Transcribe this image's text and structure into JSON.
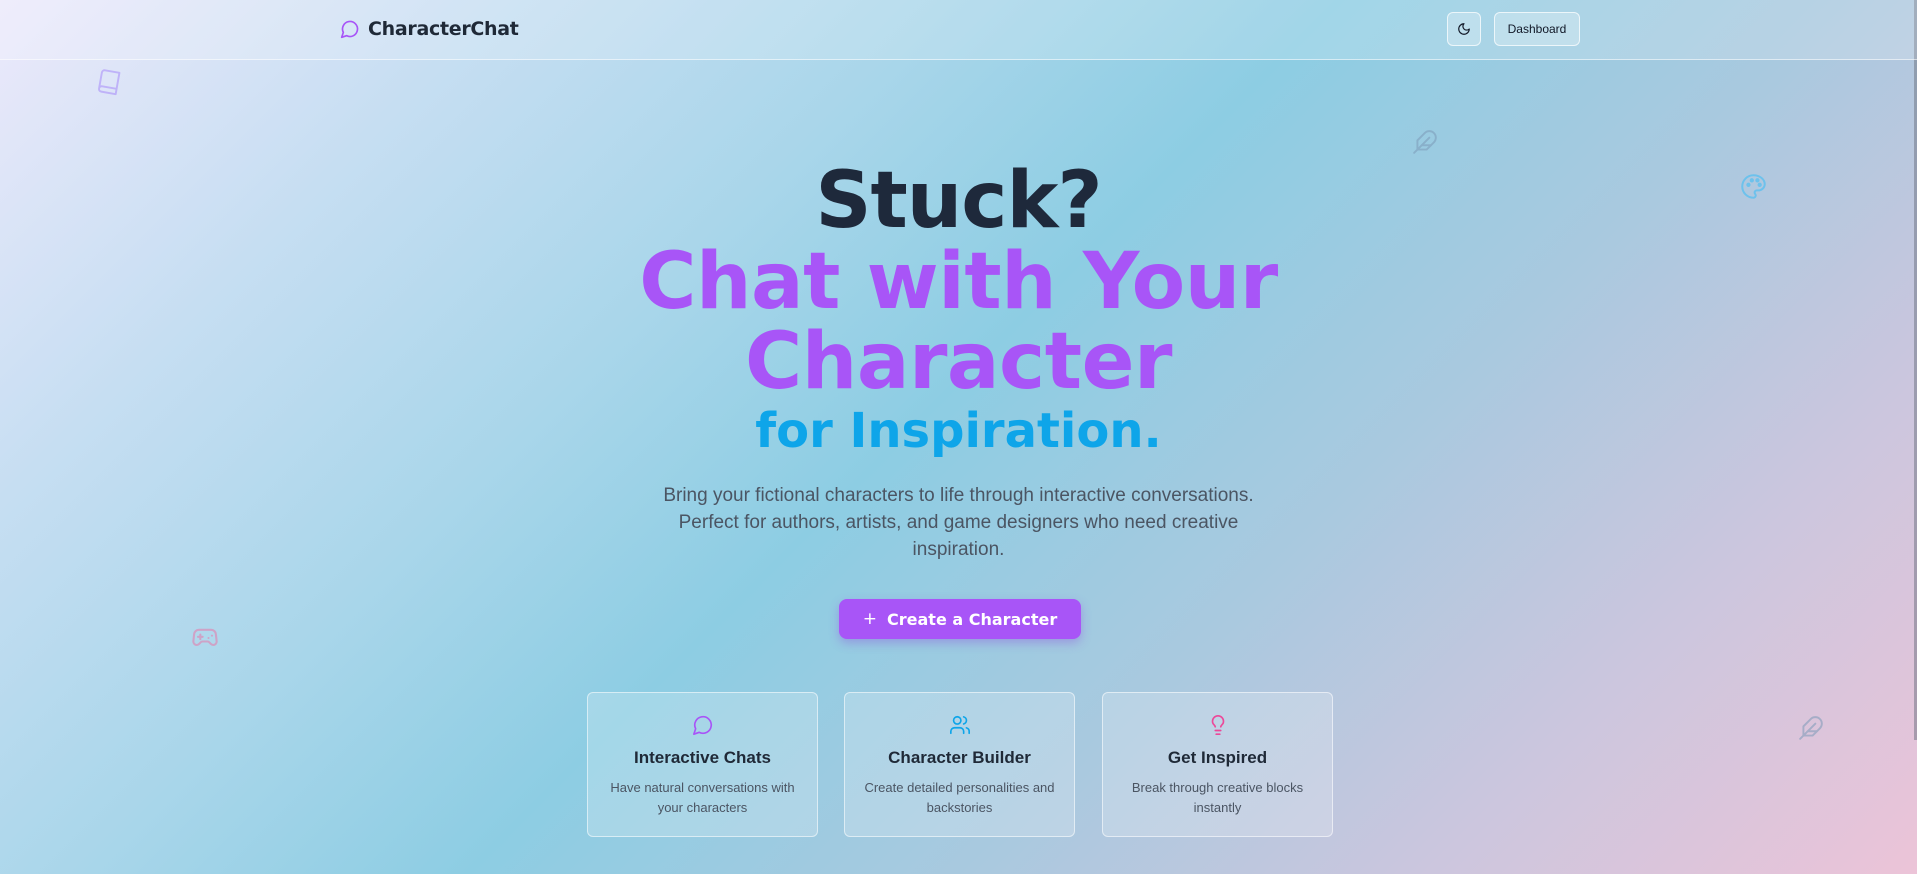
{
  "header": {
    "brand": "CharacterChat",
    "brand_icon": "message-circle-icon",
    "theme_toggle_icon": "moon-icon",
    "dashboard_label": "Dashboard"
  },
  "hero": {
    "line1": "Stuck?",
    "line2": "Chat with Your Character",
    "line3": "for Inspiration.",
    "subtitle": "Bring your fictional characters to life through interactive conversations. Perfect for authors, artists, and game designers who need creative inspiration.",
    "cta_label": "Create a Character",
    "cta_icon": "plus-icon"
  },
  "features": [
    {
      "title": "Interactive Chats",
      "description": "Have natural conversations with your characters",
      "icon": "message-circle-icon",
      "color": "#a855f7"
    },
    {
      "title": "Character Builder",
      "description": "Create detailed personalities and backstories",
      "icon": "users-icon",
      "color": "#0ea5e9"
    },
    {
      "title": "Get Inspired",
      "description": "Break through creative blocks instantly",
      "icon": "lightbulb-icon",
      "color": "#ec4899"
    }
  ],
  "decorations": [
    "book-icon",
    "feather-icon",
    "palette-icon",
    "gamepad-icon",
    "feather-icon"
  ],
  "colors": {
    "purple": "#a855f7",
    "sky": "#0ea5e9",
    "pink": "#ec4899",
    "heading": "#1e293b"
  }
}
